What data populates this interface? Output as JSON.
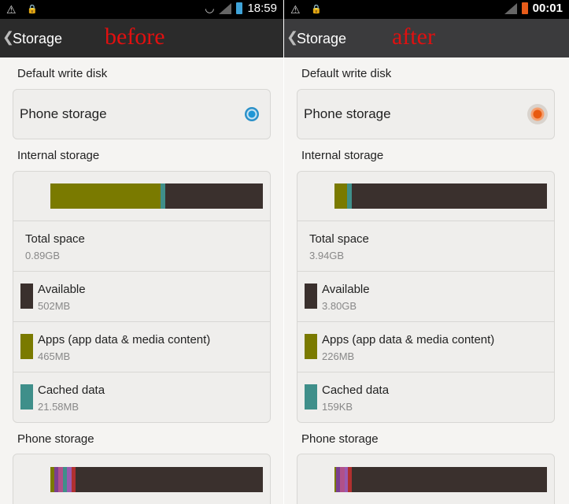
{
  "colors": {
    "available": "#3a302d",
    "apps": "#7a7a00",
    "cached": "#3f8f8a"
  },
  "panels": [
    {
      "status": {
        "time": "18:59",
        "battery_color": "#3fa4d9"
      },
      "header": {
        "title": "Storage",
        "tag": "before"
      },
      "default_write_disk": "Default write disk",
      "phone_storage_option": "Phone storage",
      "internal_label": "Internal storage",
      "usage": {
        "apps_fraction": 0.52,
        "cached_fraction": 0.02,
        "available_fraction": 0.46
      },
      "total": {
        "label": "Total space",
        "value": "0.89GB"
      },
      "available": {
        "label": "Available",
        "value": "502MB"
      },
      "apps": {
        "label": "Apps (app data & media content)",
        "value": "465MB"
      },
      "cached": {
        "label": "Cached data",
        "value": "21.58MB"
      },
      "phone_storage_label": "Phone storage"
    },
    {
      "status": {
        "time": "00:01",
        "battery_color": "#e85c1a"
      },
      "header": {
        "title": "Storage",
        "tag": "after"
      },
      "default_write_disk": "Default write disk",
      "phone_storage_option": "Phone storage",
      "internal_label": "Internal storage",
      "usage": {
        "apps_fraction": 0.06,
        "cached_fraction": 0.02,
        "available_fraction": 0.92
      },
      "total": {
        "label": "Total space",
        "value": "3.94GB"
      },
      "available": {
        "label": "Available",
        "value": "3.80GB"
      },
      "apps": {
        "label": "Apps (app data & media content)",
        "value": "226MB"
      },
      "cached": {
        "label": "Cached data",
        "value": "159KB"
      },
      "phone_storage_label": "Phone storage"
    }
  ]
}
